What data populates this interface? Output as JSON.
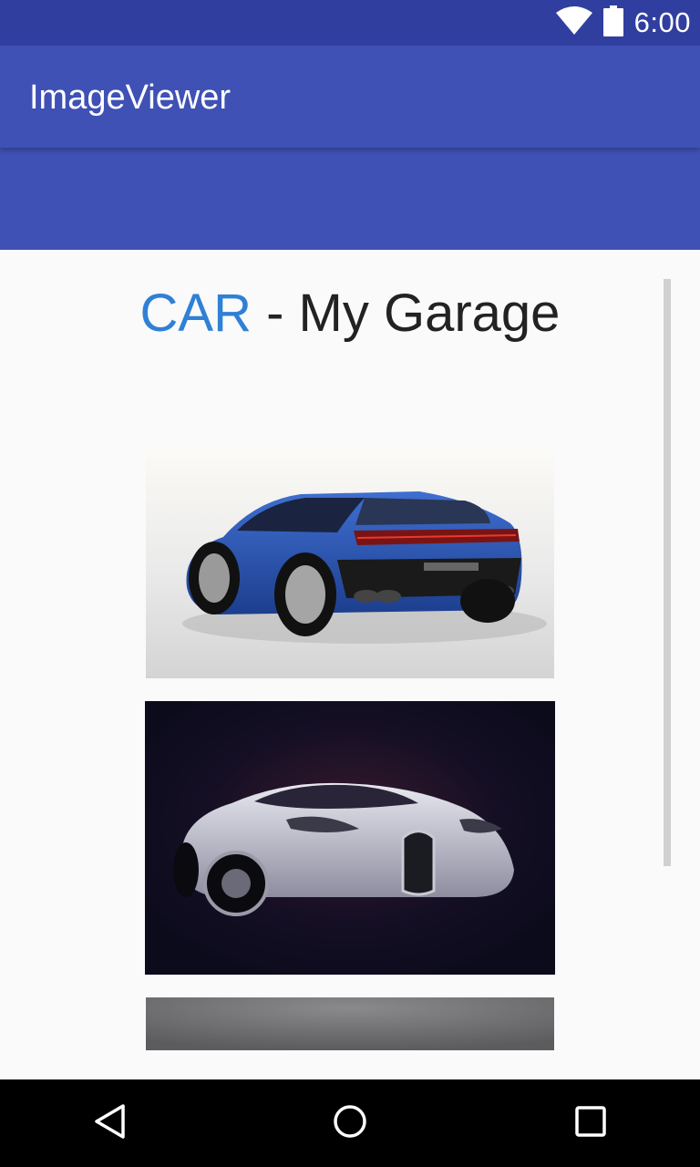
{
  "status_bar": {
    "time": "6:00",
    "icons": [
      "wifi-icon",
      "battery-icon"
    ]
  },
  "app_bar": {
    "title": "ImageViewer"
  },
  "content": {
    "heading_accent": "CAR",
    "heading_rest": " - My Garage",
    "images": [
      {
        "name": "car-image-blue-coupe"
      },
      {
        "name": "car-image-silver-supercar"
      },
      {
        "name": "car-image-partial"
      }
    ]
  },
  "nav_bar": {
    "buttons": [
      "back-icon",
      "home-icon",
      "recents-icon"
    ]
  },
  "colors": {
    "status_bar": "#303f9f",
    "primary": "#3f51b5",
    "accent_text": "#2f80d6"
  }
}
